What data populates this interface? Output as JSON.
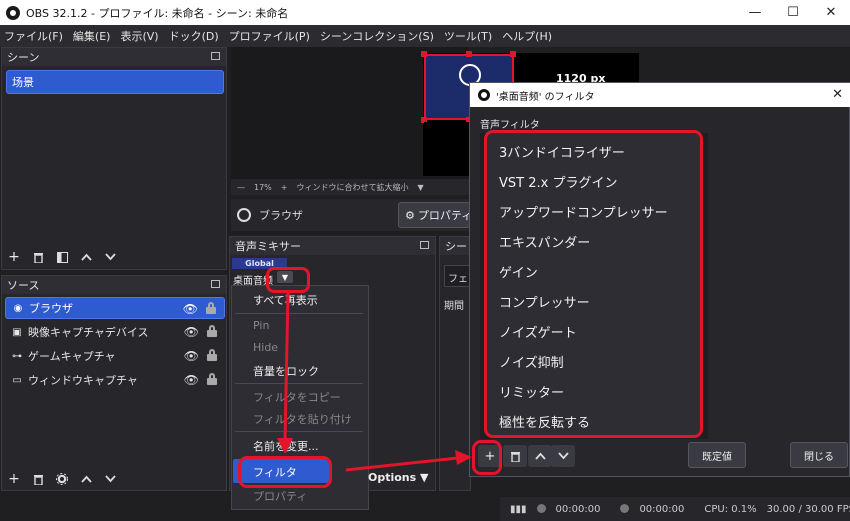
{
  "window": {
    "title": "OBS 32.1.2 - プロファイル: 未命名 - シーン: 未命名",
    "minimize": "—",
    "maximize": "☐",
    "close": "✕"
  },
  "menu": [
    "ファイル(F)",
    "編集(E)",
    "表示(V)",
    "ドック(D)",
    "プロファイル(P)",
    "シーンコレクション(S)",
    "ツール(T)",
    "ヘルプ(H)"
  ],
  "scenes": {
    "header": "シーン",
    "items": [
      "场景"
    ]
  },
  "sources": {
    "header": "ソース",
    "items": [
      {
        "label": "ブラウザ",
        "icon": "globe-icon"
      },
      {
        "label": "映像キャプチャデバイス",
        "icon": "camera-icon"
      },
      {
        "label": "ゲームキャプチャ",
        "icon": "gamepad-icon"
      },
      {
        "label": "ウィンドウキャプチャ",
        "icon": "window-icon"
      }
    ]
  },
  "preview": {
    "size_label": "1120 px",
    "zoom": "17%",
    "fit_label": "ウィンドウに合わせて拡大縮小"
  },
  "source_bar": {
    "name": "ブラウザ",
    "properties_button": "プロパティ"
  },
  "mixer": {
    "header": "音声ミキサー",
    "global_tag": "Global",
    "channel": "桌面音频"
  },
  "transitions": {
    "header": "シー",
    "field_value": "フェ",
    "duration_label": "期間"
  },
  "context_menu": {
    "items": [
      {
        "label": "すべて再表示",
        "disabled": false
      },
      {
        "label": "Pin",
        "disabled": true
      },
      {
        "label": "Hide",
        "disabled": true
      },
      {
        "label": "音量をロック",
        "disabled": false
      },
      {
        "label": "フィルタをコピー",
        "disabled": true
      },
      {
        "label": "フィルタを貼り付け",
        "disabled": true
      },
      {
        "label": "名前を変更...",
        "disabled": false
      },
      {
        "label": "フィルタ",
        "disabled": false
      },
      {
        "label": "プロパティ",
        "disabled": true
      }
    ],
    "options_button": "Options"
  },
  "statusbar": {
    "rec_time": "00:00:00",
    "stream_time": "00:00:00",
    "cpu": "CPU: 0.1%",
    "fps": "30.00 / 30.00 FPS"
  },
  "filter_dialog": {
    "title": "'桌面音频' のフィルタ",
    "section_label": "音声フィルタ",
    "menu_items": [
      "3バンドイコライザー",
      "VST 2.x プラグイン",
      "アップワードコンプレッサー",
      "エキスパンダー",
      "ゲイン",
      "コンプレッサー",
      "ノイズゲート",
      "ノイズ抑制",
      "リミッター",
      "極性を反転する"
    ],
    "defaults_button": "既定値",
    "close_button": "閉じる"
  },
  "colors": {
    "highlight_red": "#e4152a",
    "selection_blue": "#2f5bd1",
    "panel_bg": "#26262b"
  }
}
